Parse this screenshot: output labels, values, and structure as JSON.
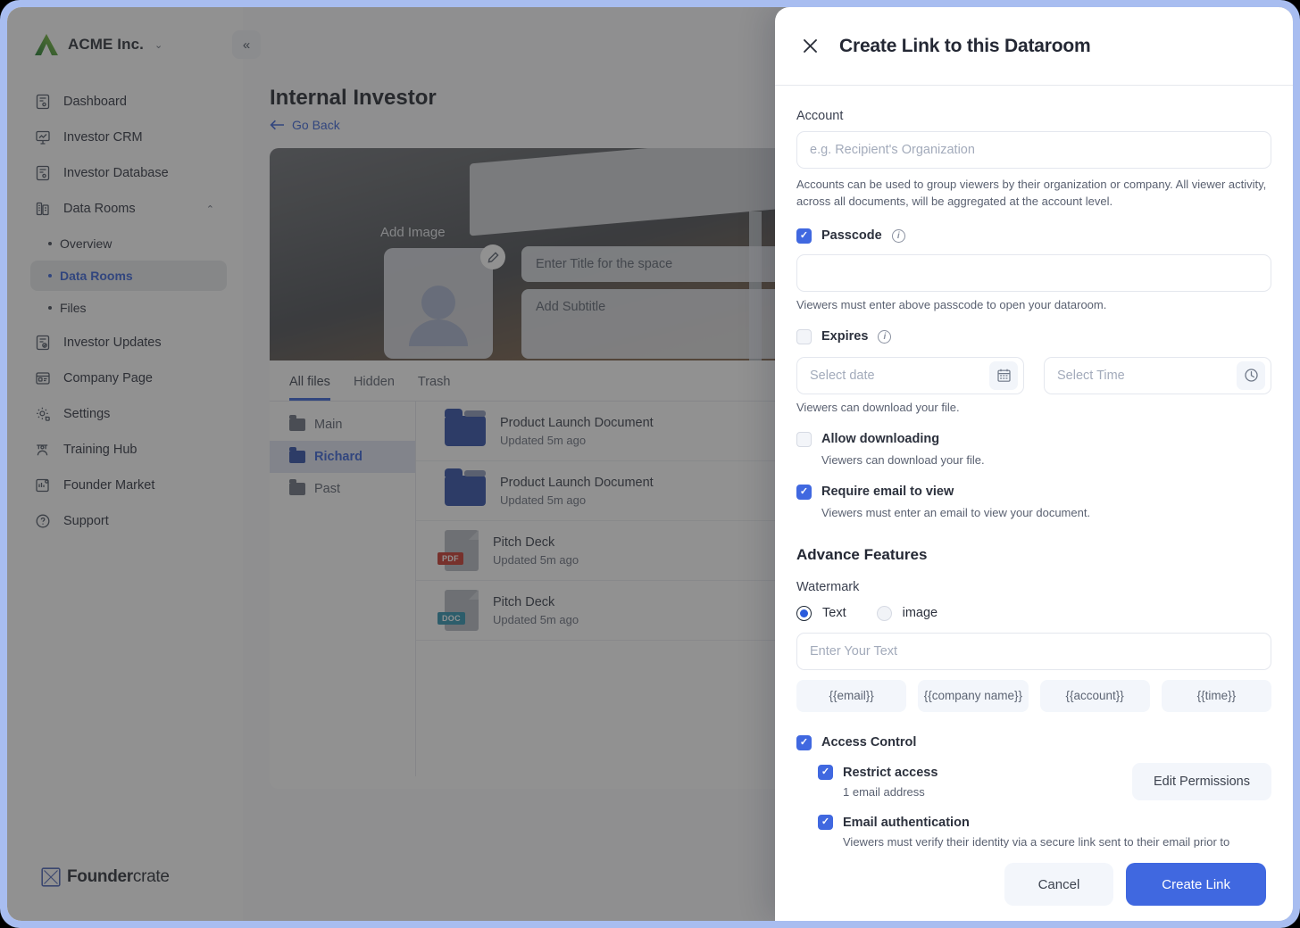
{
  "brand": {
    "name": "ACME Inc.",
    "caret": "⌄",
    "footer_logo_bold": "Founder",
    "footer_logo_light": "crate"
  },
  "sidebar": {
    "collapse_label": "«",
    "items": [
      {
        "label": "Dashboard",
        "icon": "dashboard-icon"
      },
      {
        "label": "Investor CRM",
        "icon": "crm-icon"
      },
      {
        "label": "Investor Database",
        "icon": "database-icon"
      },
      {
        "label": "Data Rooms",
        "icon": "building-icon",
        "expanded": true,
        "chevron": "⌃"
      },
      {
        "label": "Investor Updates",
        "icon": "updates-icon"
      },
      {
        "label": "Company Page",
        "icon": "company-icon"
      },
      {
        "label": "Settings",
        "icon": "gear-icon"
      },
      {
        "label": "Training Hub",
        "icon": "graduation-icon"
      },
      {
        "label": "Founder Market",
        "icon": "market-icon"
      },
      {
        "label": "Support",
        "icon": "question-icon"
      }
    ],
    "subitems": [
      {
        "label": "Overview",
        "active": false
      },
      {
        "label": "Data Rooms",
        "active": true
      },
      {
        "label": "Files",
        "active": false
      }
    ]
  },
  "main": {
    "page_title": "Internal Investor",
    "go_back": "Go Back",
    "hero": {
      "add_image": "Add Image",
      "title_placeholder": "Enter Title for the space",
      "subtitle_placeholder": "Add Subtitle",
      "edit_icon": "pencil-icon"
    },
    "tabs": [
      {
        "label": "All files",
        "active": true
      },
      {
        "label": "Hidden",
        "active": false
      },
      {
        "label": "Trash",
        "active": false
      }
    ],
    "tree": [
      {
        "label": "Main",
        "active": false
      },
      {
        "label": "Richard",
        "active": true
      },
      {
        "label": "Past",
        "active": false
      }
    ],
    "files": [
      {
        "name": "Product Launch Document",
        "meta": "Updated 5m ago",
        "kind": "folder",
        "badge": ""
      },
      {
        "name": "Product Launch Document",
        "meta": "Updated 5m ago",
        "kind": "folder",
        "badge": ""
      },
      {
        "name": "Pitch Deck",
        "meta": "Updated 5m ago",
        "kind": "file",
        "badge": "PDF",
        "badge_color": "#c8372d"
      },
      {
        "name": "Pitch Deck",
        "meta": "Updated 5m ago",
        "kind": "file",
        "badge": "DOC",
        "badge_color": "#2f93b0"
      }
    ]
  },
  "modal": {
    "title": "Create Link to this Dataroom",
    "close_icon": "close-icon",
    "account": {
      "label": "Account",
      "placeholder": "e.g. Recipient's Organization",
      "value": "",
      "help": "Accounts can be used to group viewers by their organization or company. All viewer activity, across all documents, will be aggregated at the account level."
    },
    "passcode": {
      "label": "Passcode",
      "checked": true,
      "value": "",
      "info_icon": "info-icon",
      "help": "Viewers must enter above passcode to open your dataroom."
    },
    "expires": {
      "label": "Expires",
      "checked": false,
      "info_icon": "info-icon",
      "date_placeholder": "Select date",
      "date_value": "",
      "date_icon": "calendar-icon",
      "time_placeholder": "Select Time",
      "time_value": "",
      "time_icon": "clock-icon",
      "help": "Viewers can download your file."
    },
    "allow_downloading": {
      "label": "Allow downloading",
      "checked": false,
      "help": "Viewers can download your file."
    },
    "require_email": {
      "label": "Require email to view",
      "checked": true,
      "help": "Viewers must enter an email to view your document."
    },
    "advance_features": {
      "title": "Advance Features",
      "watermark_label": "Watermark",
      "options": [
        {
          "label": "Text",
          "selected": true
        },
        {
          "label": "image",
          "selected": false
        }
      ],
      "text_placeholder": "Enter Your Text",
      "text_value": "",
      "chips": [
        "{{email}}",
        "{{company name}}",
        "{{account}}",
        "{{time}}"
      ]
    },
    "access_control": {
      "label": "Access Control",
      "checked": true,
      "restrict": {
        "label": "Restrict access",
        "checked": true,
        "help": "1 email address",
        "button": "Edit Permissions"
      },
      "email_auth": {
        "label": "Email authentication",
        "checked": true,
        "help": "Viewers must verify their identity via a secure link sent to their email prior to accessing your Space."
      }
    },
    "footer": {
      "cancel": "Cancel",
      "submit": "Create Link"
    }
  },
  "colors": {
    "accent": "#4068e0",
    "link": "#3a63d8",
    "frame": "#a8bdf0",
    "folder": "#2f4fa8"
  }
}
